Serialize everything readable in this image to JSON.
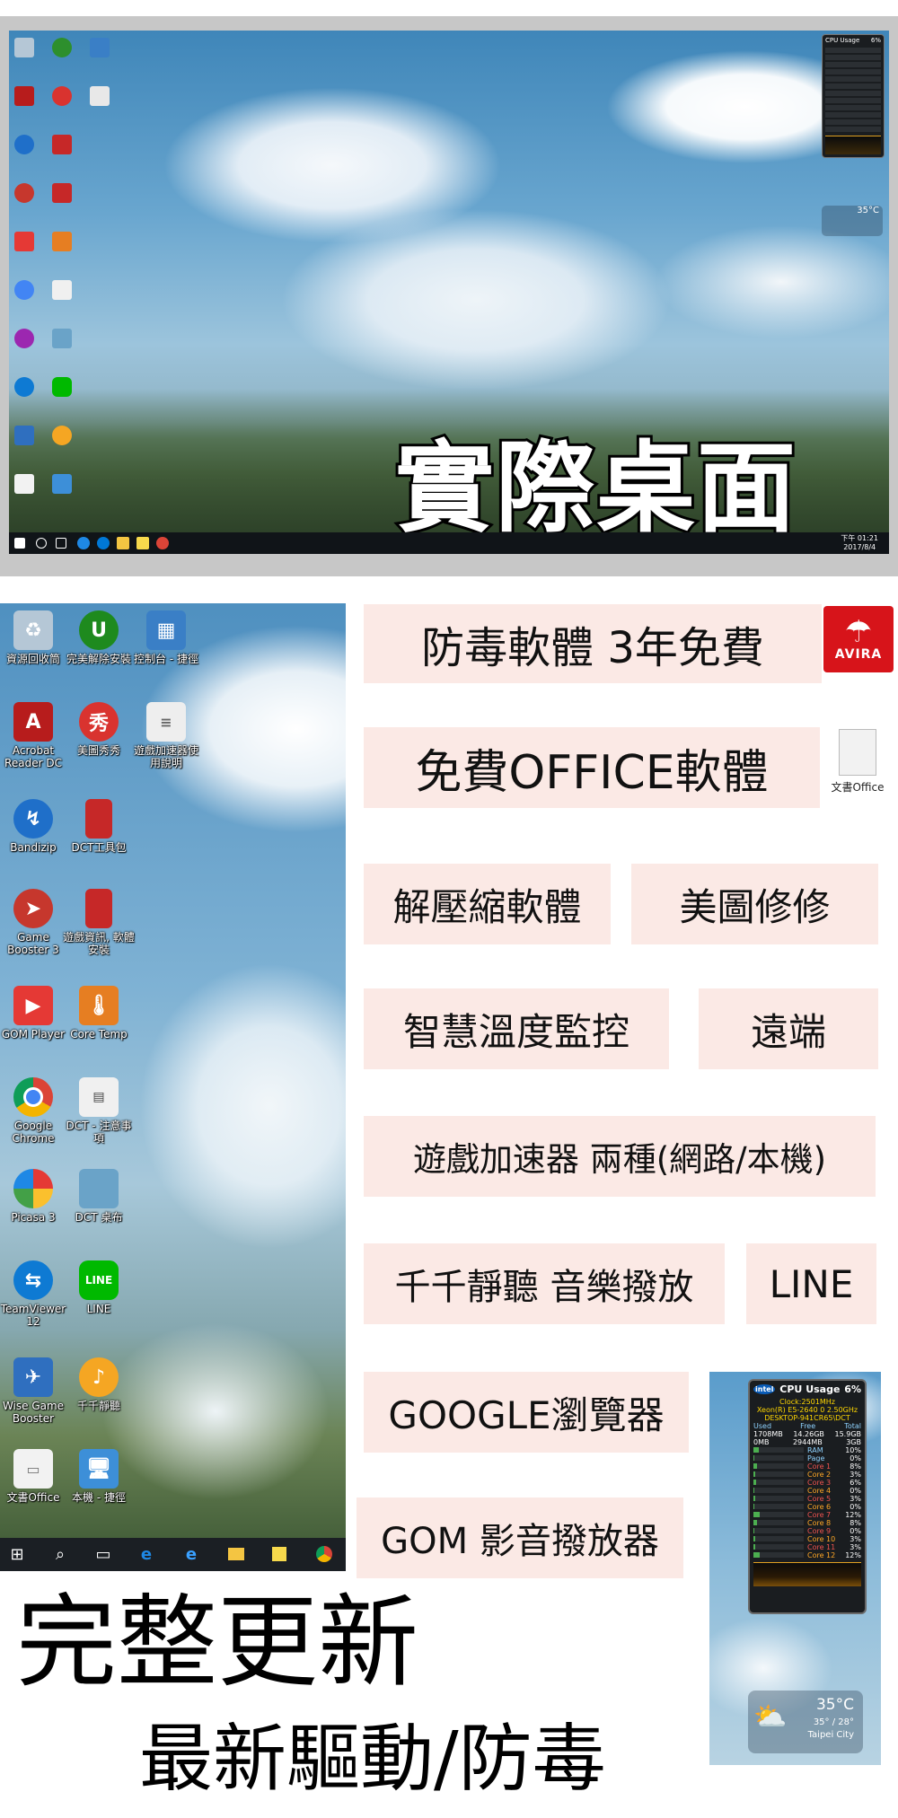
{
  "top_banner": {
    "overlay_title": "實際桌面",
    "cpu_gadget_title": "CPU Usage",
    "cpu_gadget_value": "6%",
    "weather_temp": "35°C",
    "clock_time": "下午 01:21",
    "clock_date": "2017/8/4"
  },
  "desktop_icons": [
    {
      "label": "資源回收筒",
      "icon": "recycle-bin-icon",
      "color": "#9fb7c9"
    },
    {
      "label": "完美解除安裝",
      "icon": "uninstaller-icon",
      "color": "#2d8f2d"
    },
    {
      "label": "控制台 - 捷徑",
      "icon": "control-panel-icon",
      "color": "#3a7fc6"
    },
    {
      "label": "Acrobat Reader DC",
      "icon": "acrobat-icon",
      "color": "#b71c1c"
    },
    {
      "label": "美圖秀秀",
      "icon": "meitu-icon",
      "color": "#d9332f"
    },
    {
      "label": "遊戲加速器使用說明",
      "icon": "document-icon",
      "color": "#e8e8e8"
    },
    {
      "label": "Bandizip",
      "icon": "bandizip-icon",
      "color": "#1f6fc9"
    },
    {
      "label": "DCT工具包",
      "icon": "red-folder-icon",
      "color": "#c62828"
    },
    {
      "label": "Game Booster 3",
      "icon": "game-booster-icon",
      "color": "#c6372d"
    },
    {
      "label": "遊戲資訊, 軟體安裝",
      "icon": "red-folder-icon",
      "color": "#c62828"
    },
    {
      "label": "GOM Player",
      "icon": "gom-player-icon",
      "color": "#e53935"
    },
    {
      "label": "Core Temp",
      "icon": "thermometer-icon",
      "color": "#e67e22"
    },
    {
      "label": "Google Chrome",
      "icon": "chrome-icon",
      "color": "#4285f4"
    },
    {
      "label": "DCT - 注意事項",
      "icon": "notes-icon",
      "color": "#f0f0f0"
    },
    {
      "label": "Picasa 3",
      "icon": "picasa-icon",
      "color": "#9c27b0"
    },
    {
      "label": "DCT 桌布",
      "icon": "wallpaper-icon",
      "color": "#6aa3c8"
    },
    {
      "label": "TeamViewer 12",
      "icon": "teamviewer-icon",
      "color": "#0e7ad3"
    },
    {
      "label": "LINE",
      "icon": "line-icon",
      "color": "#00b900"
    },
    {
      "label": "Wise Game Booster",
      "icon": "wise-booster-icon",
      "color": "#2f6fbf"
    },
    {
      "label": "千千靜聽",
      "icon": "ttplayer-icon",
      "color": "#f5a623"
    },
    {
      "label": "文書Office",
      "icon": "office-doc-icon",
      "color": "#f2f2f2"
    },
    {
      "label": "本機 - 捷徑",
      "icon": "computer-icon",
      "color": "#3d8fd8"
    }
  ],
  "taskbar": {
    "start": "start-icon",
    "items": [
      "search-icon",
      "task-view-icon",
      "ie-icon",
      "edge-icon",
      "explorer-icon",
      "sticky-notes-icon",
      "chrome-icon"
    ]
  },
  "features": [
    {
      "label": "防毒軟體 3年免費",
      "badge": "AVIRA"
    },
    {
      "label": "免費OFFICE軟體",
      "badge": "文書Office"
    },
    {
      "label": "解壓縮軟體"
    },
    {
      "label": "美圖修修"
    },
    {
      "label": "智慧溫度監控"
    },
    {
      "label": "遠端"
    },
    {
      "label": "遊戲加速器 兩種(網路/本機)"
    },
    {
      "label": "千千靜聽 音樂撥放"
    },
    {
      "label": "LINE"
    },
    {
      "label": "GOOGLE瀏覽器"
    },
    {
      "label": "GOM 影音撥放器"
    }
  ],
  "cpu_gadget": {
    "title": "CPU Usage",
    "usage": "6%",
    "clock": "Clock:2501MHz",
    "cpu": "Xeon(R) E5-2640 0 2.50GHz",
    "host": "DESKTOP-941CR65\\DCT",
    "mem_header": [
      "Used",
      "Free",
      "Total"
    ],
    "mem_row1": [
      "1708MB",
      "14.26GB",
      "15.9GB"
    ],
    "mem_row2": [
      "0MB",
      "2944MB",
      "3GB"
    ],
    "rows": [
      {
        "name": "RAM",
        "value": "10%"
      },
      {
        "name": "Page",
        "value": "0%"
      },
      {
        "name": "Core 1",
        "value": "8%"
      },
      {
        "name": "Core 2",
        "value": "3%"
      },
      {
        "name": "Core 3",
        "value": "6%"
      },
      {
        "name": "Core 4",
        "value": "0%"
      },
      {
        "name": "Core 5",
        "value": "3%"
      },
      {
        "name": "Core 6",
        "value": "0%"
      },
      {
        "name": "Core 7",
        "value": "12%"
      },
      {
        "name": "Core 8",
        "value": "8%"
      },
      {
        "name": "Core 9",
        "value": "0%"
      },
      {
        "name": "Core 10",
        "value": "3%"
      },
      {
        "name": "Core 11",
        "value": "3%"
      },
      {
        "name": "Core 12",
        "value": "12%"
      }
    ]
  },
  "weather": {
    "temp": "35°C",
    "range": "35° / 28°",
    "city": "Taipei City"
  },
  "headline": {
    "main": "完整更新",
    "sub": "最新驅動/防毒"
  },
  "colors": {
    "pill_bg": "#fbe9e5",
    "avira_red": "#d7141a",
    "taskbar": "#1b1f24"
  }
}
